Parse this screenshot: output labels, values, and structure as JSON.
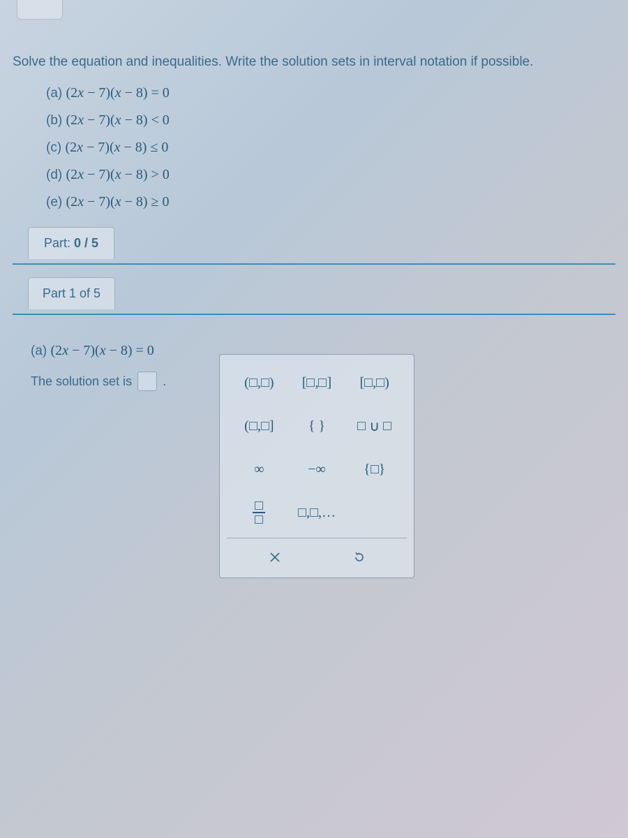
{
  "instruction": "Solve the equation and inequalities. Write the solution sets in interval notation if possible.",
  "problems": {
    "a": {
      "label": "(a)",
      "expr": "(2x − 7)(x − 8) = 0"
    },
    "b": {
      "label": "(b)",
      "expr": "(2x − 7)(x − 8) < 0"
    },
    "c": {
      "label": "(c)",
      "expr": "(2x − 7)(x − 8) ≤ 0"
    },
    "d": {
      "label": "(d)",
      "expr": "(2x − 7)(x − 8) > 0"
    },
    "e": {
      "label": "(e)",
      "expr": "(2x − 7)(x − 8) ≥ 0"
    }
  },
  "progress": {
    "prefix": "Part:",
    "value": "0 / 5"
  },
  "part_header": "Part 1 of 5",
  "current": {
    "label": "(a)",
    "expr": "(2x − 7)(x − 8) = 0",
    "prompt": "The solution set is",
    "suffix": "."
  },
  "palette": {
    "open_open": "(▫,▫)",
    "closed_closed": "[▫,▫]",
    "closed_open": "[▫,▫)",
    "open_closed": "(▫,▫]",
    "braces": "{ }",
    "union": "▫∪▫",
    "inf": "∞",
    "neg_inf": "−∞",
    "set_single": "{▫}",
    "fraction": "▫/▫",
    "list": "▫,▫,…",
    "clear_title": "Clear",
    "reset_title": "Reset"
  }
}
